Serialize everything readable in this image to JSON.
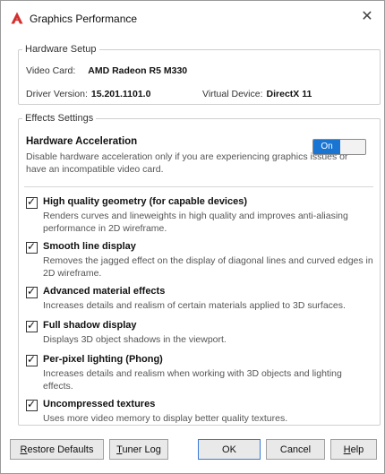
{
  "window": {
    "title": "Graphics Performance"
  },
  "hardware": {
    "legend": "Hardware Setup",
    "video_card_label": "Video Card:",
    "video_card": "AMD Radeon R5 M330",
    "driver_label": "Driver Version:",
    "driver": "15.201.1101.0",
    "virtual_label": "Virtual Device:",
    "virtual": "DirectX 11"
  },
  "effects": {
    "legend": "Effects Settings",
    "hw_accel": {
      "title": "Hardware Acceleration",
      "desc": "Disable hardware acceleration only if you are experiencing graphics issues or have an incompatible video card.",
      "toggle_label": "On"
    },
    "options": [
      {
        "title": "High quality geometry (for capable devices)",
        "desc": "Renders curves and lineweights in high quality and improves anti-aliasing performance in 2D wireframe.",
        "checked": true
      },
      {
        "title": "Smooth line display",
        "desc": "Removes the jagged effect on the display of diagonal lines and curved edges in 2D wireframe.",
        "checked": true
      },
      {
        "title": "Advanced material effects",
        "desc": "Increases details and realism of certain materials applied to 3D surfaces.",
        "checked": true
      },
      {
        "title": "Full shadow display",
        "desc": "Displays 3D object shadows in the viewport.",
        "checked": true
      },
      {
        "title": "Per-pixel lighting (Phong)",
        "desc": "Increases details and realism when working with 3D objects and lighting effects.",
        "checked": true
      },
      {
        "title": "Uncompressed textures",
        "desc": "Uses more video memory to display better quality textures.",
        "checked": true
      }
    ]
  },
  "buttons": {
    "restore": {
      "first": "R",
      "rest": "estore Defaults"
    },
    "tuner": {
      "first": "T",
      "rest": "uner Log"
    },
    "ok": "OK",
    "cancel": "Cancel",
    "help": {
      "first": "H",
      "rest": "elp"
    }
  },
  "colors": {
    "accent": "#1a75d2",
    "app_icon": "#d32f2f"
  }
}
